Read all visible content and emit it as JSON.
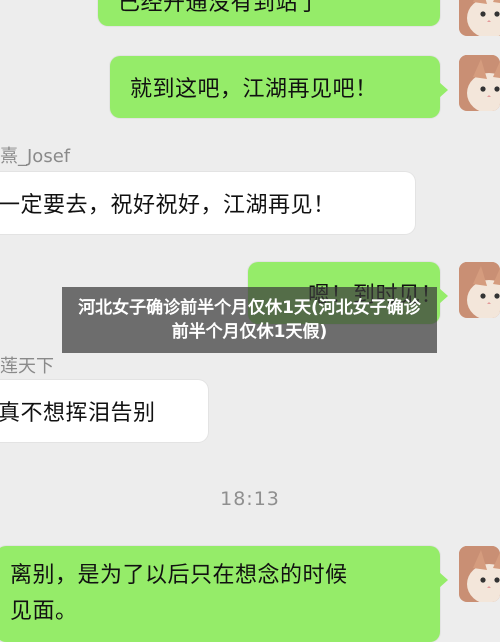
{
  "messages": [
    {
      "side": "me",
      "text": "已经开通没有到站了"
    },
    {
      "side": "me",
      "text": "就到这吧，江湖再见吧！"
    },
    {
      "sender": "熹_Josef",
      "side": "them",
      "text": "一定要去，祝好祝好，江湖再见！"
    },
    {
      "side": "me",
      "text": "嗯！到时见！"
    },
    {
      "sender": "莲天下",
      "side": "them",
      "text": "真不想挥泪告别"
    },
    {
      "side": "me",
      "text_line1": "离别，是为了以后只在想念的时候",
      "text_line2": "见面。"
    }
  ],
  "timestamp": "18:13",
  "overlay_title": "河北女子确诊前半个月仅休1天(河北女子确诊前半个月仅休1天假)",
  "colors": {
    "background": "#ededed",
    "my_bubble": "#95ec69",
    "their_bubble": "#ffffff",
    "overlay_bg": "rgba(60,60,60,0.72)"
  },
  "avatar_icon": "cat-icon"
}
